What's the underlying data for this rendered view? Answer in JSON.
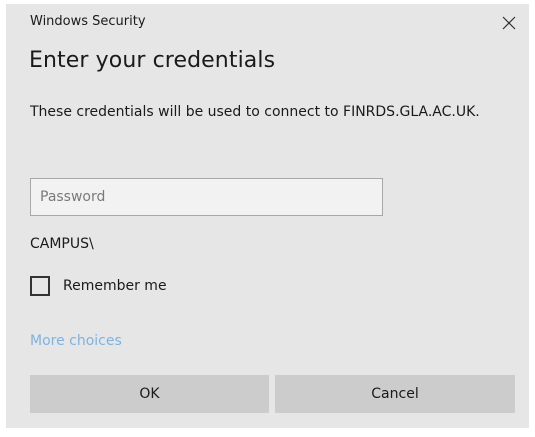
{
  "window": {
    "title": "Windows Security"
  },
  "dialog": {
    "heading": "Enter your credentials",
    "message": "These credentials will be used to connect to FINRDS.GLA.AC.UK."
  },
  "password": {
    "placeholder": "Password",
    "value": ""
  },
  "domain_prefix": "CAMPUS\\",
  "remember": {
    "label": "Remember me",
    "checked": false
  },
  "more_choices_label": "More choices",
  "buttons": {
    "ok_label": "OK",
    "cancel_label": "Cancel"
  },
  "icons": {
    "close": "close-icon"
  },
  "colors": {
    "background": "#e6e6e6",
    "button": "#cccccc",
    "link": "#7fb3e0",
    "text": "#1a1a1a"
  }
}
